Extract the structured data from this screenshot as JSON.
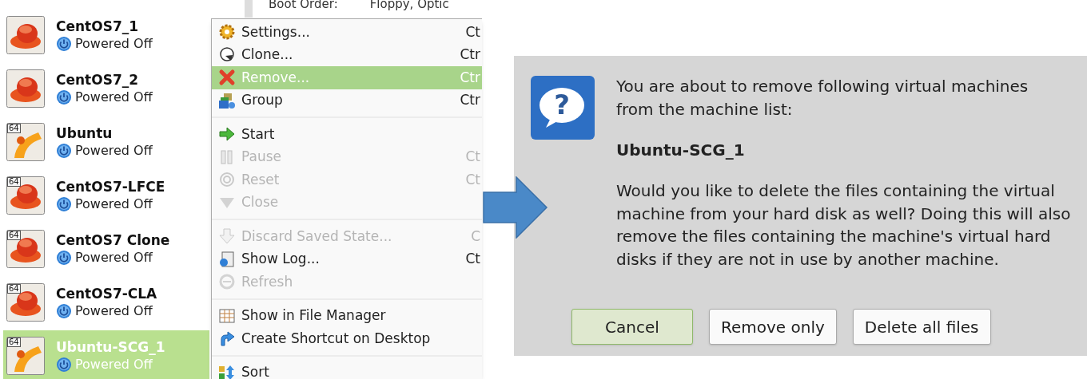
{
  "details": {
    "label": "Boot Order:",
    "value": "Floppy, Optic"
  },
  "vms": [
    {
      "name": "CentOS7_1",
      "status": "Powered Off",
      "kind": "redhat",
      "selected": false
    },
    {
      "name": "CentOS7_2",
      "status": "Powered Off",
      "kind": "redhat",
      "selected": false
    },
    {
      "name": "Ubuntu",
      "status": "Powered Off",
      "badge": "64",
      "kind": "ubuntu",
      "selected": false
    },
    {
      "name": "CentOS7-LFCE",
      "status": "Powered Off",
      "badge": "64",
      "kind": "redhat",
      "selected": false
    },
    {
      "name": "CentOS7 Clone",
      "status": "Powered Off",
      "badge": "64",
      "kind": "redhat",
      "selected": false
    },
    {
      "name": "CentOS7-CLA",
      "status": "Powered Off",
      "badge": "64",
      "kind": "redhat",
      "selected": false
    },
    {
      "name": "Ubuntu-SCG_1",
      "status": "Powered Off",
      "badge": "64",
      "kind": "ubuntu",
      "selected": true
    }
  ],
  "menu": [
    [
      {
        "label": "Settings...",
        "shortcut": "Ct",
        "disabled": false,
        "selected": false
      },
      {
        "label": "Clone...",
        "shortcut": "Ctr",
        "disabled": false,
        "selected": false
      },
      {
        "label": "Remove...",
        "shortcut": "Ctr",
        "disabled": false,
        "selected": true
      },
      {
        "label": "Group",
        "shortcut": "Ctr",
        "disabled": false,
        "selected": false
      }
    ],
    [
      {
        "label": "Start",
        "disabled": false,
        "selected": false
      },
      {
        "label": "Pause",
        "shortcut": "Ct",
        "disabled": true,
        "selected": false
      },
      {
        "label": "Reset",
        "shortcut": "Ct",
        "disabled": true,
        "selected": false
      },
      {
        "label": "Close",
        "disabled": true,
        "selected": false
      }
    ],
    [
      {
        "label": "Discard Saved State...",
        "shortcut": "C",
        "disabled": true,
        "selected": false
      },
      {
        "label": "Show Log...",
        "shortcut": "Ct",
        "disabled": false,
        "selected": false
      },
      {
        "label": "Refresh",
        "disabled": true,
        "selected": false
      }
    ],
    [
      {
        "label": "Show in File Manager",
        "disabled": false,
        "selected": false
      },
      {
        "label": "Create Shortcut on Desktop",
        "disabled": false,
        "selected": false
      }
    ],
    [
      {
        "label": "Sort",
        "disabled": false,
        "selected": false
      }
    ]
  ],
  "dialog": {
    "icon_glyph": "?",
    "message": "You are about to remove following virtual machines from the machine list:",
    "vm_name": "Ubuntu-SCG_1",
    "question": "Would you like to delete the files containing the virtual machine from your hard disk as well? Doing this will also remove the files containing the machine's virtual hard disks if they are not in use by another machine.",
    "buttons": [
      {
        "label": "Cancel",
        "default": true
      },
      {
        "label": "Remove only",
        "default": false
      },
      {
        "label": "Delete all files",
        "default": false
      }
    ]
  }
}
